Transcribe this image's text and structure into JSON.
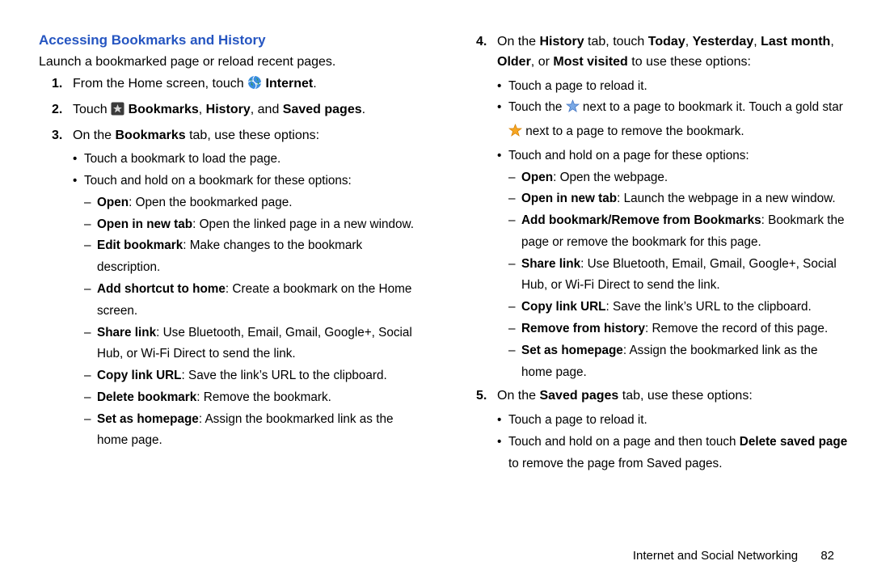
{
  "heading": "Accessing Bookmarks and History",
  "intro": "Launch a bookmarked page or reload recent pages.",
  "step1": {
    "pre": "From the Home screen, touch ",
    "post": " Internet",
    "period": "."
  },
  "step2": {
    "pre": "Touch ",
    "b1": " Bookmarks",
    "sep1": ", ",
    "b2": "History",
    "sep2": ", and ",
    "b3": "Saved pages",
    "period": "."
  },
  "step3": {
    "lead_pre": "On the ",
    "lead_b": "Bookmarks",
    "lead_post": " tab, use these options:",
    "bul1": "Touch a bookmark to load the page.",
    "bul2": "Touch and hold on a bookmark for these options:",
    "d1b": "Open",
    "d1t": ": Open the bookmarked page.",
    "d2b": "Open in new tab",
    "d2t": ": Open the linked page in a new window.",
    "d3b": "Edit bookmark",
    "d3t": ": Make changes to the bookmark description.",
    "d4b": "Add shortcut to home",
    "d4t": ": Create a bookmark on the Home screen.",
    "d5b": "Share link",
    "d5t": ": Use Bluetooth, Email, Gmail, Google+, Social Hub, or Wi-Fi Direct to send the link.",
    "d6b": "Copy link URL",
    "d6t": ": Save the link’s URL to the clipboard.",
    "d7b": "Delete bookmark",
    "d7t": ": Remove the bookmark.",
    "d8b": "Set as homepage",
    "d8t": ": Assign the bookmarked link as the home page."
  },
  "step4": {
    "lead_pre": "On the ",
    "lead_b1": "History",
    "lead_mid1": " tab, touch ",
    "lead_b2": "Today",
    "sep1": ", ",
    "lead_b3": "Yesterday",
    "sep2": ", ",
    "lead_b4": "Last month",
    "sep3": ", ",
    "lead_b5": "Older",
    "sep4": ", or ",
    "lead_b6": "Most visited",
    "lead_post": " to use these options:",
    "bul1": "Touch a page to reload it.",
    "bul2_a": "Touch the ",
    "bul2_b": " next to a page to bookmark it. Touch a gold star ",
    "bul2_c": " next to a page to remove the bookmark.",
    "bul3": "Touch and hold on a page for these options:",
    "d1b": "Open",
    "d1t": ": Open the webpage.",
    "d2b": "Open in new tab",
    "d2t": ": Launch the webpage in a new window.",
    "d3b": "Add bookmark/Remove from Bookmarks",
    "d3t": ": Bookmark the page or remove the bookmark for this page.",
    "d4b": "Share link",
    "d4t": ": Use Bluetooth, Email, Gmail, Google+, Social Hub, or Wi-Fi Direct to send the link.",
    "d5b": "Copy link URL",
    "d5t": ": Save the link’s URL to the clipboard.",
    "d6b": "Remove from history",
    "d6t": ": Remove the record of this page.",
    "d7b": "Set as homepage",
    "d7t": ": Assign the bookmarked link as the home page."
  },
  "step5": {
    "lead_pre": "On the ",
    "lead_b": "Saved pages",
    "lead_post": " tab, use these options:",
    "bul1": "Touch a page to reload it.",
    "bul2_a": "Touch and hold on a page and then touch ",
    "bul2_b": "Delete saved page",
    "bul2_c": " to remove the page from Saved pages."
  },
  "footer": {
    "section": "Internet and Social Networking",
    "page": "82"
  }
}
